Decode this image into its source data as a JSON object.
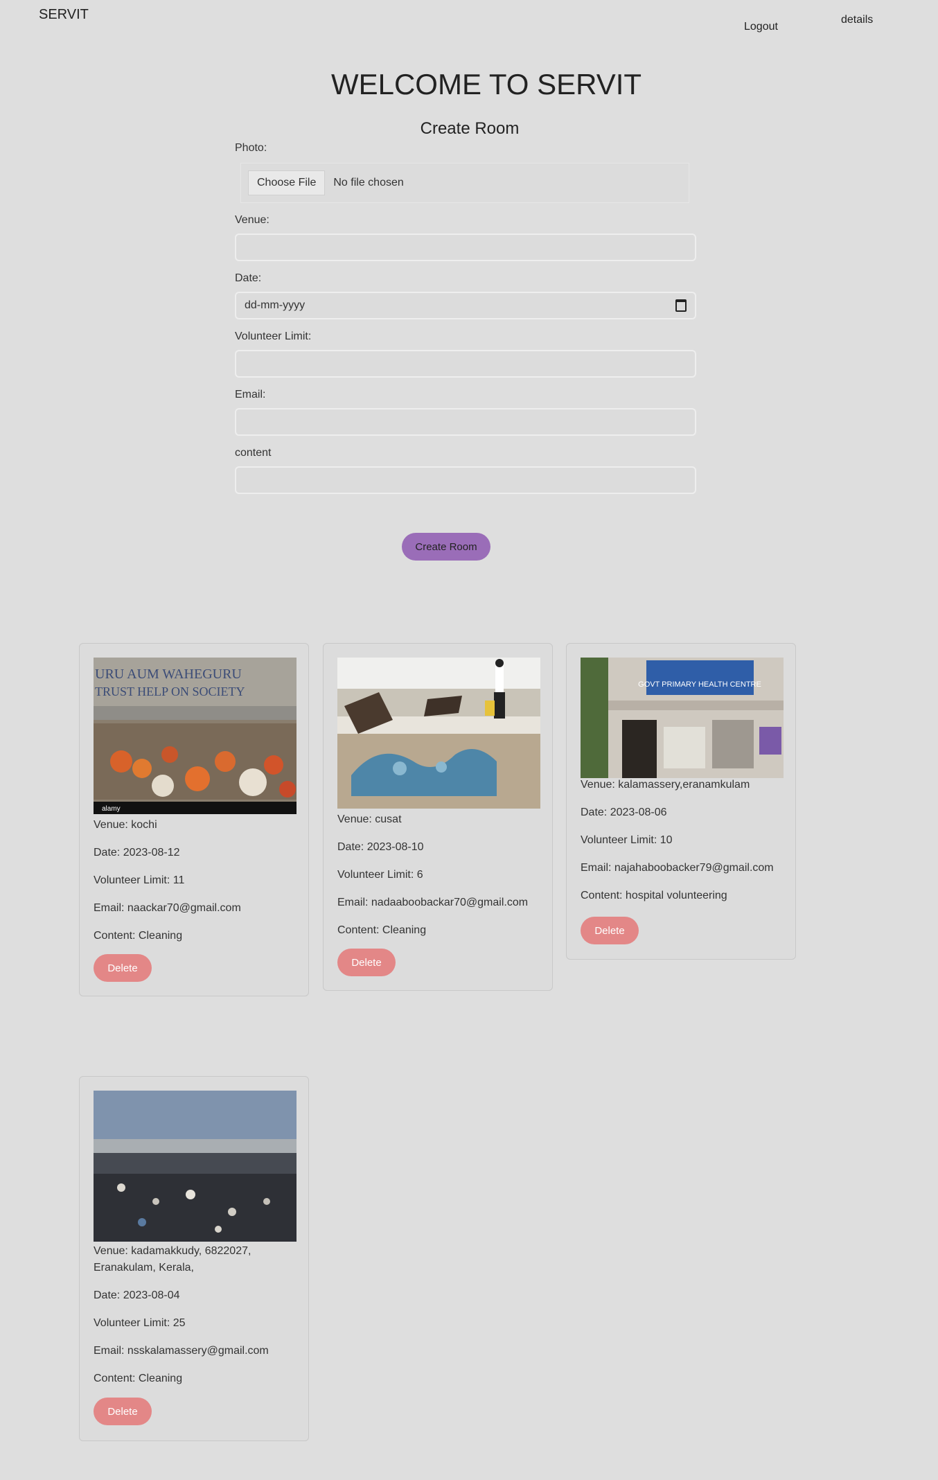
{
  "nav": {
    "brand": "SERVIT",
    "logout": "Logout",
    "details": "details"
  },
  "header": {
    "welcome": "WELCOME TO SERVIT",
    "form_title": "Create Room"
  },
  "form": {
    "photo_label": "Photo:",
    "choose_file": "Choose File",
    "no_file": "No file chosen",
    "venue_label": "Venue:",
    "date_label": "Date:",
    "date_placeholder": "dd-mm-yyyy",
    "limit_label": "Volunteer Limit:",
    "email_label": "Email:",
    "content_label": "content",
    "submit": "Create Room"
  },
  "colors": {
    "accent": "#9a6db8",
    "delete": "#e38787",
    "background": "#dedede"
  },
  "rooms": [
    {
      "venue": "Venue: kochi",
      "date": "Date: 2023-08-12",
      "limit": "Volunteer Limit: 11",
      "email": "Email: naackar70@gmail.com",
      "content": "Content: Cleaning",
      "delete": "Delete",
      "photo": "crowd-photo",
      "photo_caption": "alamy"
    },
    {
      "venue": "Venue: cusat",
      "date": "Date: 2023-08-10",
      "limit": "Volunteer Limit: 6",
      "email": "Email: nadaaboobackar70@gmail.com",
      "content": "Content: Cleaning",
      "delete": "Delete",
      "photo": "beach-debris-photo"
    },
    {
      "venue": "Venue: kalamassery,eranamkulam",
      "date": "Date: 2023-08-06",
      "limit": "Volunteer Limit: 10",
      "email": "Email: najahaboobacker79@gmail.com",
      "content": "Content: hospital volunteering",
      "delete": "Delete",
      "photo": "health-centre-photo",
      "photo_caption": "GOVT PRIMARY HEALTH CENTRE"
    },
    {
      "venue": "Venue: kadamakkudy, 6822027, Eranakulam, Kerala,",
      "date": "Date: 2023-08-04",
      "limit": "Volunteer Limit: 25",
      "email": "Email: nsskalamassery@gmail.com",
      "content": "Content: Cleaning",
      "delete": "Delete",
      "photo": "polluted-shore-photo"
    }
  ]
}
